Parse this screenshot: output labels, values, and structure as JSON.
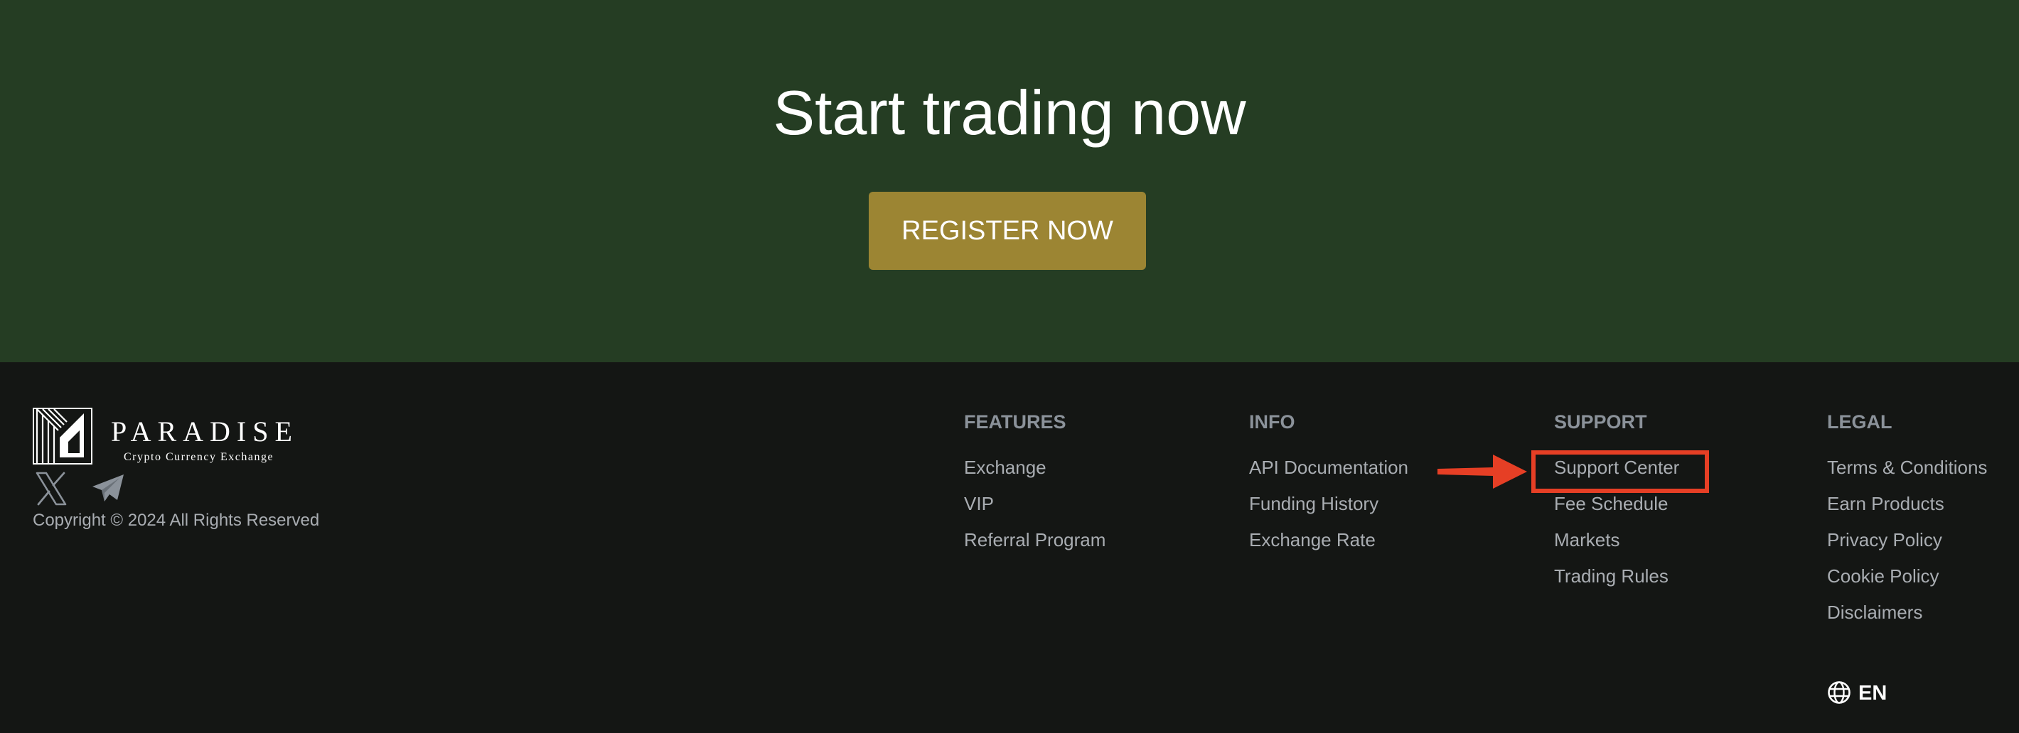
{
  "hero": {
    "title": "Start trading now",
    "register_label": "REGISTER NOW"
  },
  "brand": {
    "name": "PARADISE",
    "tagline": "Crypto Currency Exchange",
    "copyright": "Copyright © 2024 All Rights Reserved"
  },
  "social": [
    {
      "icon": "x-icon"
    },
    {
      "icon": "telegram-icon"
    }
  ],
  "columns": [
    {
      "heading": "FEATURES",
      "links": [
        "Exchange",
        "VIP",
        "Referral Program"
      ]
    },
    {
      "heading": "INFO",
      "links": [
        "API Documentation",
        "Funding History",
        "Exchange Rate"
      ]
    },
    {
      "heading": "SUPPORT",
      "links": [
        "Support Center",
        "Fee Schedule",
        "Markets",
        "Trading Rules"
      ]
    },
    {
      "heading": "LEGAL",
      "links": [
        "Terms & Conditions",
        "Earn Products",
        "Privacy Policy",
        "Cookie Policy",
        "Disclaimers"
      ]
    }
  ],
  "language": {
    "icon": "globe-icon",
    "code": "EN"
  },
  "annotation": {
    "target": "Support Center",
    "color": "#e63f25"
  },
  "colors": {
    "hero_bg": "#253d23",
    "button_bg": "#9c8533",
    "footer_bg": "#141614",
    "heading": "#8b929a",
    "link": "#a9adb2"
  }
}
